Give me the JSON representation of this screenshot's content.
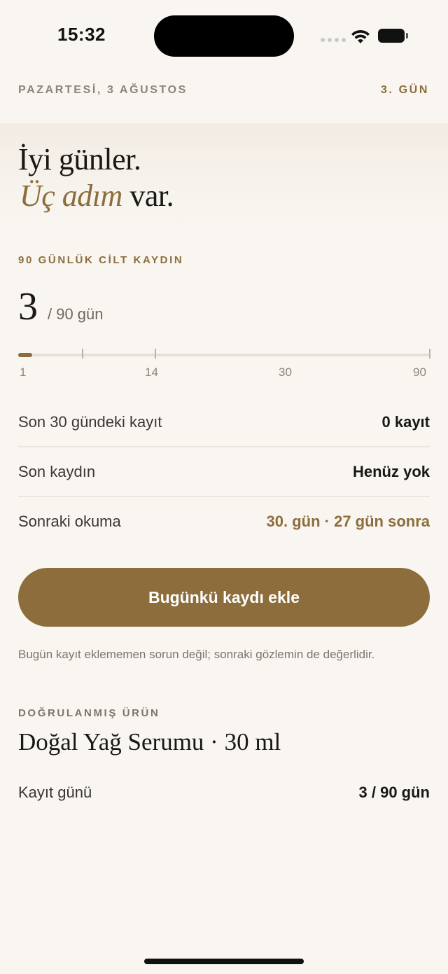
{
  "status": {
    "time": "15:32"
  },
  "header": {
    "date": "PAZARTESİ, 3 AĞUSTOS",
    "day": "3. GÜN"
  },
  "hero": {
    "line1": "İyi günler.",
    "accent": "Üç adım",
    "rest": " var."
  },
  "journey": {
    "label": "90 GÜNLÜK CİLT KAYDIN",
    "current": "3",
    "total": "/ 90 gün",
    "progress_day": 3,
    "max_day": 90,
    "tick_labels": [
      "1",
      "14",
      "30",
      "90"
    ]
  },
  "stats": [
    {
      "label": "Son 30 gündeki kayıt",
      "value": "0 kayıt"
    },
    {
      "label": "Son kaydın",
      "value": "Henüz yok"
    },
    {
      "label": "Sonraki okuma",
      "value": "30. gün · 27 gün sonra"
    }
  ],
  "cta": {
    "label": "Bugünkü kaydı ekle"
  },
  "note": "Bugün kayıt eklememen sorun değil; sonraki gözlemin de değerlidir.",
  "product": {
    "label": "DOĞRULANMIŞ ÜRÜN",
    "name": "Doğal Yağ Serumu · 30 ml",
    "row_label": "Kayıt günü",
    "row_value": "3 / 90 gün"
  },
  "colors": {
    "accent": "#8c6d3b",
    "background": "#f9f6f1",
    "text": "#1a1815"
  }
}
